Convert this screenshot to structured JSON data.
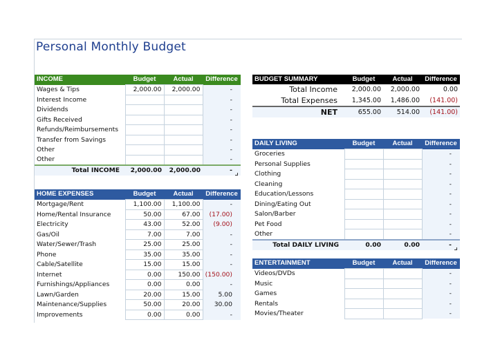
{
  "title": "Personal Monthly Budget",
  "columns": {
    "budget": "Budget",
    "actual": "Actual",
    "difference": "Difference"
  },
  "income": {
    "header": "INCOME",
    "rows": [
      {
        "label": "Wages & Tips",
        "budget": "2,000.00",
        "actual": "2,000.00",
        "diff": "-"
      },
      {
        "label": "Interest Income",
        "budget": "",
        "actual": "",
        "diff": "-"
      },
      {
        "label": "Dividends",
        "budget": "",
        "actual": "",
        "diff": "-"
      },
      {
        "label": "Gifts Received",
        "budget": "",
        "actual": "",
        "diff": "-"
      },
      {
        "label": "Refunds/Reimbursements",
        "budget": "",
        "actual": "",
        "diff": "-"
      },
      {
        "label": "Transfer from Savings",
        "budget": "",
        "actual": "",
        "diff": "-"
      },
      {
        "label": "Other",
        "budget": "",
        "actual": "",
        "diff": "-"
      },
      {
        "label": "Other",
        "budget": "",
        "actual": "",
        "diff": "-"
      }
    ],
    "total": {
      "label": "Total INCOME",
      "budget": "2,000.00",
      "actual": "2,000.00",
      "diff": "-"
    }
  },
  "home_expenses": {
    "header": "HOME EXPENSES",
    "rows": [
      {
        "label": "Mortgage/Rent",
        "budget": "1,100.00",
        "actual": "1,100.00",
        "diff": "-"
      },
      {
        "label": "Home/Rental Insurance",
        "budget": "50.00",
        "actual": "67.00",
        "diff": "(17.00)",
        "negative": true
      },
      {
        "label": "Electricity",
        "budget": "43.00",
        "actual": "52.00",
        "diff": "(9.00)",
        "negative": true
      },
      {
        "label": "Gas/Oil",
        "budget": "7.00",
        "actual": "7.00",
        "diff": "-"
      },
      {
        "label": "Water/Sewer/Trash",
        "budget": "25.00",
        "actual": "25.00",
        "diff": "-"
      },
      {
        "label": "Phone",
        "budget": "35.00",
        "actual": "35.00",
        "diff": "-"
      },
      {
        "label": "Cable/Satellite",
        "budget": "15.00",
        "actual": "15.00",
        "diff": "-"
      },
      {
        "label": "Internet",
        "budget": "0.00",
        "actual": "150.00",
        "diff": "(150.00)",
        "negative": true
      },
      {
        "label": "Furnishings/Appliances",
        "budget": "0.00",
        "actual": "0.00",
        "diff": "-"
      },
      {
        "label": "Lawn/Garden",
        "budget": "20.00",
        "actual": "15.00",
        "diff": "5.00"
      },
      {
        "label": "Maintenance/Supplies",
        "budget": "50.00",
        "actual": "20.00",
        "diff": "30.00"
      },
      {
        "label": "Improvements",
        "budget": "0.00",
        "actual": "0.00",
        "diff": "-"
      }
    ]
  },
  "summary": {
    "header": "BUDGET SUMMARY",
    "rows": [
      {
        "label": "Total Income",
        "budget": "2,000.00",
        "actual": "2,000.00",
        "diff": "0.00"
      },
      {
        "label": "Total Expenses",
        "budget": "1,345.00",
        "actual": "1,486.00",
        "diff": "(141.00)",
        "negative": true
      }
    ],
    "net": {
      "label": "NET",
      "budget": "655.00",
      "actual": "514.00",
      "diff": "(141.00)",
      "negative": true
    }
  },
  "daily_living": {
    "header": "DAILY LIVING",
    "rows": [
      {
        "label": "Groceries",
        "budget": "",
        "actual": "",
        "diff": "-"
      },
      {
        "label": "Personal Supplies",
        "budget": "",
        "actual": "",
        "diff": "-"
      },
      {
        "label": "Clothing",
        "budget": "",
        "actual": "",
        "diff": "-"
      },
      {
        "label": "Cleaning",
        "budget": "",
        "actual": "",
        "diff": "-"
      },
      {
        "label": "Education/Lessons",
        "budget": "",
        "actual": "",
        "diff": "-"
      },
      {
        "label": "Dining/Eating Out",
        "budget": "",
        "actual": "",
        "diff": "-"
      },
      {
        "label": "Salon/Barber",
        "budget": "",
        "actual": "",
        "diff": "-"
      },
      {
        "label": "Pet Food",
        "budget": "",
        "actual": "",
        "diff": "-"
      },
      {
        "label": "Other",
        "budget": "",
        "actual": "",
        "diff": "-"
      }
    ],
    "total": {
      "label": "Total DAILY LIVING",
      "budget": "0.00",
      "actual": "0.00",
      "diff": "-"
    }
  },
  "entertainment": {
    "header": "ENTERTAINMENT",
    "rows": [
      {
        "label": "Videos/DVDs",
        "budget": "",
        "actual": "",
        "diff": "-"
      },
      {
        "label": "Music",
        "budget": "",
        "actual": "",
        "diff": "-"
      },
      {
        "label": "Games",
        "budget": "",
        "actual": "",
        "diff": "-"
      },
      {
        "label": "Rentals",
        "budget": "",
        "actual": "",
        "diff": "-"
      },
      {
        "label": "Movies/Theater",
        "budget": "",
        "actual": "",
        "diff": "-"
      }
    ]
  },
  "colors": {
    "income_header": "#3a8a1f",
    "section_header": "#2e5aa0",
    "summary_header": "#000000",
    "negative": "#a4121b",
    "title": "#1f3f8f"
  }
}
